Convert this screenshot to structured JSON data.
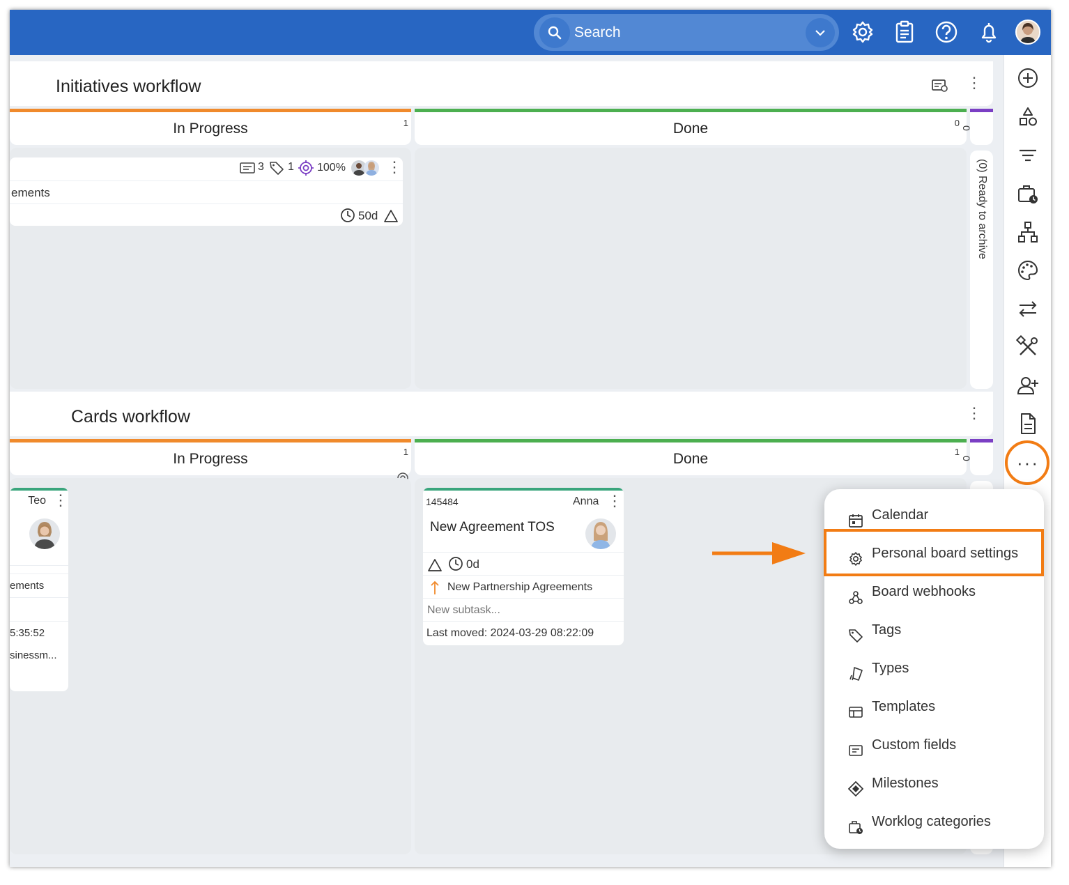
{
  "topbar": {
    "search_placeholder": "Search",
    "icons": [
      "gear-icon",
      "clipboard-icon",
      "help-icon",
      "bell-icon"
    ],
    "color": "#2866c2"
  },
  "rail_icons": [
    "plus-circle-icon",
    "shapes-icon",
    "filter-icon",
    "worklog-icon",
    "hierarchy-icon",
    "palette-icon",
    "swap-icon",
    "tools-icon",
    "add-user-icon",
    "document-icon"
  ],
  "initiatives": {
    "title": "Initiatives workflow",
    "lanes": [
      {
        "name": "In Progress",
        "count": "1",
        "color": "#f08a2c"
      },
      {
        "name": "Done",
        "count": "0",
        "color": "#4caf50"
      },
      {
        "collapsed_count": "0",
        "collapsed_label": "(0) Ready to archive",
        "color": "#7b3fc4"
      }
    ],
    "card": {
      "comments": "3",
      "tags": "1",
      "progress": "100%",
      "title_fragment": "ements",
      "age": "50d"
    }
  },
  "cards_wf": {
    "title": "Cards workflow",
    "lanes": [
      {
        "name": "In Progress",
        "count": "1",
        "color": "#f08a2c"
      },
      {
        "name": "Done",
        "count": "1",
        "color": "#4caf50"
      },
      {
        "collapsed_count": "0",
        "color": "#7b3fc4"
      }
    ],
    "left_card": {
      "owner": "Teo",
      "line1": "ements",
      "line2": "5:35:52",
      "line3": "sinessm..."
    },
    "done_card": {
      "id": "145484",
      "owner": "Anna",
      "title": "New Agreement TOS",
      "age": "0d",
      "parent": "New Partnership Agreements",
      "subtask_placeholder": "New subtask...",
      "last_moved": "Last moved: 2024-03-29 08:22:09",
      "accent": "#3aa57c"
    }
  },
  "menu": {
    "items": [
      {
        "label": "Calendar",
        "icon": "calendar-icon"
      },
      {
        "label": "Personal board settings",
        "icon": "gear-icon"
      },
      {
        "label": "Board webhooks",
        "icon": "webhook-icon"
      },
      {
        "label": "Tags",
        "icon": "tag-icon"
      },
      {
        "label": "Types",
        "icon": "types-icon"
      },
      {
        "label": "Templates",
        "icon": "template-icon"
      },
      {
        "label": "Custom fields",
        "icon": "custom-fields-icon"
      },
      {
        "label": "Milestones",
        "icon": "milestone-icon"
      },
      {
        "label": "Worklog categories",
        "icon": "worklog-icon"
      }
    ],
    "highlight_color": "#f27c14"
  }
}
